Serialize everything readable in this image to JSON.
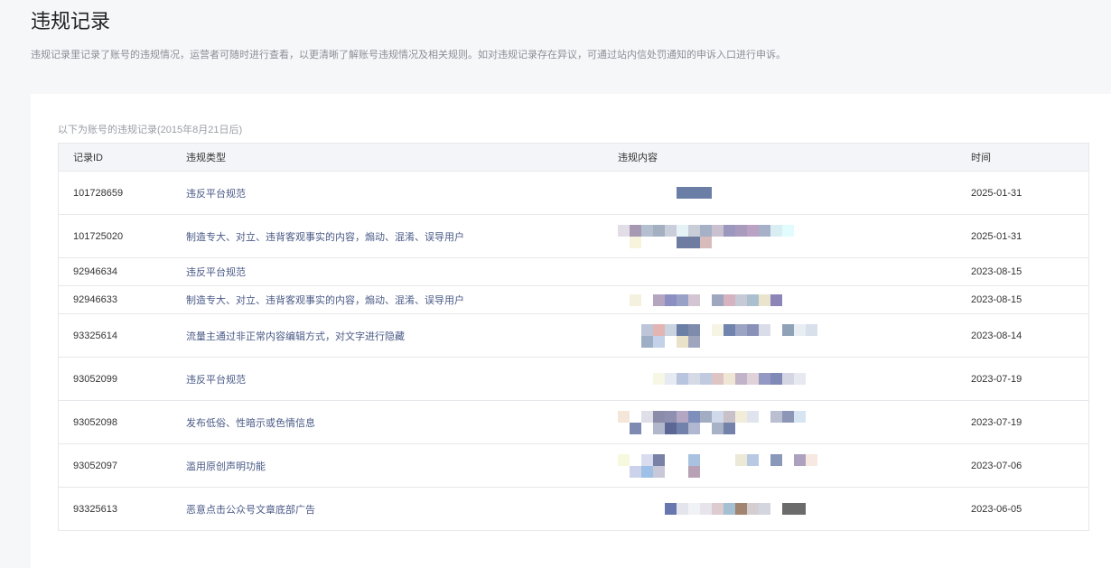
{
  "header": {
    "title": "违规记录",
    "description": "违规记录里记录了账号的违规情况，运营者可随时进行查看，以更清晰了解账号违规情况及相关规则。如对违规记录存在异议，可通过站内信处罚通知的申诉入口进行申诉。"
  },
  "table": {
    "caption": "以下为账号的违规记录(2015年8月21日后)",
    "columns": {
      "id": "记录ID",
      "type": "违规类型",
      "content": "违规内容",
      "time": "时间"
    },
    "rows": [
      {
        "id": "101728659",
        "type": "违反平台规范",
        "time": "2025-01-31",
        "height": 48,
        "mosaic": [
          [
            null,
            null,
            null,
            null,
            null,
            "#6b7ea6",
            "#6b7ea6",
            "#6b7ea6"
          ]
        ]
      },
      {
        "id": "101725020",
        "type": "制造专大、对立、违背客观事实的内容，煽动、混淆、误导用户",
        "time": "2025-01-31",
        "height": 48,
        "mosaic": [
          [
            "#e3dde8",
            "#a799b4",
            "#b4c0cf",
            "#a5afc2",
            "#c9ceda",
            "#e6f3f6",
            "#c9cdd7",
            "#a5b1c6",
            "#cac1d0",
            "#9c98bd",
            "#a99bbd",
            "#b9a2c3",
            "#a6b0c9",
            "#d9eef2",
            "#e2fbfd"
          ],
          [
            null,
            "#f7f3dc",
            null,
            null,
            null,
            "#6e7ca2",
            "#6e7ca2",
            "#d8bcbc"
          ]
        ]
      },
      {
        "id": "92946634",
        "type": "违反平台规范",
        "time": "2023-08-15",
        "height": 31,
        "mosaic": []
      },
      {
        "id": "92946633",
        "type": "制造专大、对立、违背客观事实的内容，煽动、混淆、误导用户",
        "time": "2023-08-15",
        "height": 31,
        "mosaic": [
          [
            null,
            "#f4f2df",
            null,
            "#b6a5c1",
            "#8c8fc1",
            "#9aa1c7",
            "#d3c6d2",
            null,
            "#9ea7bd",
            "#d5b3c0",
            "#c6c9d6",
            "#aac0cf",
            "#eae4cd",
            "#8c85b8"
          ]
        ]
      },
      {
        "id": "93325614",
        "type": "流量主通过非正常内容编辑方式，对文字进行隐藏",
        "time": "2023-08-14",
        "height": 48,
        "mosaic": [
          [
            null,
            null,
            "#bcc6d8",
            "#e2b5b2",
            "#cad3e0",
            "#6b7ea6",
            "#7e8bab",
            null,
            "#f5f4e5",
            "#7184ad",
            "#9ca4c3",
            "#8a91b8",
            "#dadde8",
            null,
            "#8fa2b8",
            "#e8eef4",
            "#d8e0ec"
          ],
          [
            null,
            null,
            "#9eaec4",
            "#c3d2e8",
            null,
            "#e9e2c8",
            "#9fa5bc"
          ]
        ]
      },
      {
        "id": "93052099",
        "type": "违反平台规范",
        "time": "2023-07-19",
        "height": 48,
        "mosaic": [
          [
            null,
            null,
            null,
            "#f7f7e5",
            "#e5eaf3",
            "#b9c4de",
            "#d6dae6",
            "#c1cbe0",
            "#dec4c4",
            "#efe6d4",
            "#c2b4c8",
            "#e0d2d8",
            "#9399c2",
            "#7f8bb6",
            "#d4d6e3",
            "#e7e9f0"
          ]
        ]
      },
      {
        "id": "93052098",
        "type": "发布低俗、性暗示或色情信息",
        "time": "2023-07-19",
        "height": 48,
        "mosaic": [
          [
            "#f5e6da",
            null,
            "#dedfe9",
            "#8b8ca9",
            "#8f8fb1",
            "#b3a7c3",
            "#7e8fbb",
            "#a2adc3",
            "#cfd9e9",
            "#c9c1c9",
            "#f2edd9",
            "#dfe4ee",
            null,
            "#babfd1",
            "#8d96b6",
            "#d7e5f3"
          ],
          [
            null,
            "#7f8ab2",
            null,
            "#b2b8cc",
            "#5d6796",
            "#7382ab",
            "#b0b8d1",
            null,
            "#a8b2c6",
            "#7382ab"
          ]
        ]
      },
      {
        "id": "93052097",
        "type": "滥用原创声明功能",
        "time": "2023-07-06",
        "height": 48,
        "mosaic": [
          [
            "#f8f8de",
            null,
            "#d9dcee",
            "#7982a6",
            null,
            null,
            "#a9c2e0",
            null,
            null,
            null,
            "#ece9d7",
            "#b8c9e4",
            null,
            "#8a98b9",
            null,
            "#aca2bf",
            "#f8e8e2"
          ],
          [
            null,
            "#cbd2ec",
            "#9fc0e6",
            "#c8c8d8",
            null,
            null,
            "#b8a0b5"
          ]
        ]
      },
      {
        "id": "93325613",
        "type": "恶意点击公众号文章底部广告",
        "time": "2023-06-05",
        "height": 48,
        "mosaic": [
          [
            null,
            null,
            null,
            null,
            "#6876b0",
            "#e4e4ec",
            "#f1f2f5",
            "#e7e4ec",
            "#dccbcf",
            "#a4c0d2",
            "#a28570",
            "#d4ced0",
            "#d3d6de",
            null,
            "#6b6b6b",
            "#6b6b6b"
          ]
        ]
      }
    ]
  }
}
